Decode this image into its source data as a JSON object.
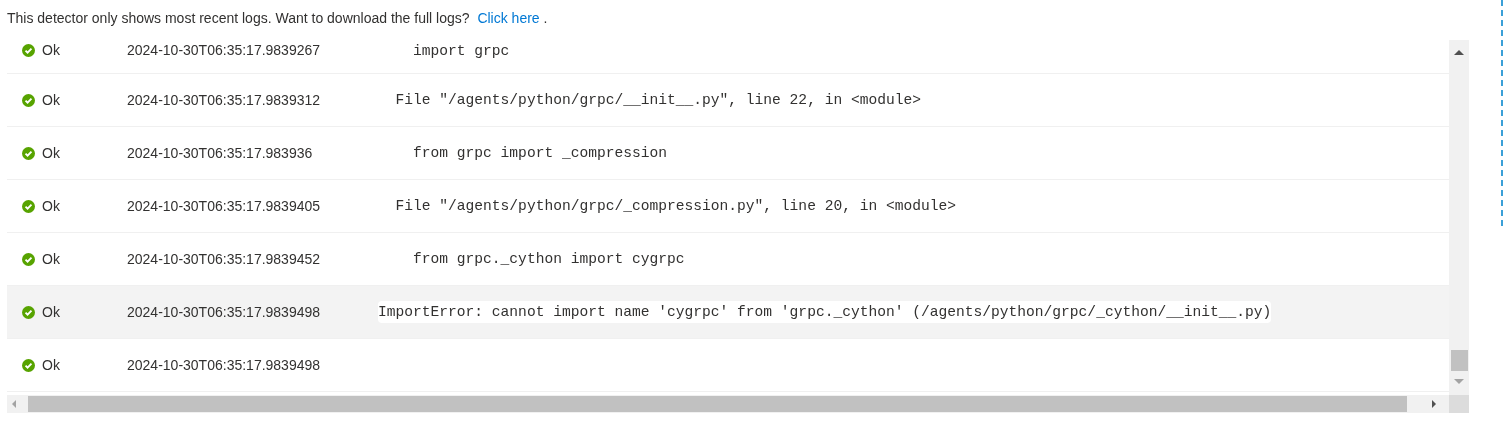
{
  "notice": {
    "text": "This detector only shows most recent logs. Want to download the full logs?",
    "link": "Click here",
    "end": "."
  },
  "rows": [
    {
      "status": "Ok",
      "kind": "ok",
      "timestamp": "2024-10-30T06:35:17.9839267",
      "message": "    import grpc",
      "highlighted": false
    },
    {
      "status": "Ok",
      "kind": "ok",
      "timestamp": "2024-10-30T06:35:17.9839312",
      "message": "  File \"/agents/python/grpc/__init__.py\", line 22, in <module>",
      "highlighted": false
    },
    {
      "status": "Ok",
      "kind": "ok",
      "timestamp": "2024-10-30T06:35:17.983936",
      "message": "    from grpc import _compression",
      "highlighted": false
    },
    {
      "status": "Ok",
      "kind": "ok",
      "timestamp": "2024-10-30T06:35:17.9839405",
      "message": "  File \"/agents/python/grpc/_compression.py\", line 20, in <module>",
      "highlighted": false
    },
    {
      "status": "Ok",
      "kind": "ok",
      "timestamp": "2024-10-30T06:35:17.9839452",
      "message": "    from grpc._cython import cygrpc",
      "highlighted": false
    },
    {
      "status": "Ok",
      "kind": "ok",
      "timestamp": "2024-10-30T06:35:17.9839498",
      "message": "ImportError: cannot import name 'cygrpc' from 'grpc._cython' (/agents/python/grpc/_cython/__init__.py)",
      "highlighted": true
    },
    {
      "status": "Ok",
      "kind": "ok",
      "timestamp": "2024-10-30T06:35:17.9839498",
      "highlighted": false
    }
  ]
}
